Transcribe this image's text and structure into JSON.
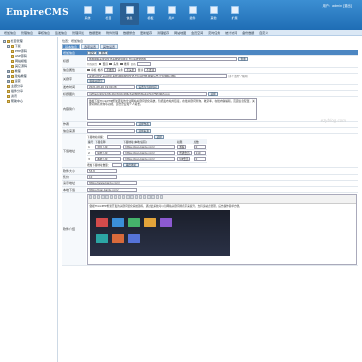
{
  "brand": {
    "logo_main": "EmpireCMS",
    "logo_sub": ""
  },
  "topnav": [
    {
      "label": "系统"
    },
    {
      "label": "栏目"
    },
    {
      "label": "信息"
    },
    {
      "label": "模板"
    },
    {
      "label": "用户"
    },
    {
      "label": "插件"
    },
    {
      "label": "其他"
    },
    {
      "label": "扩展"
    }
  ],
  "user": {
    "text": "用户：admin [退出]"
  },
  "subnav": [
    "增加信息",
    "管理信息",
    "审核信息",
    "签发信息",
    "管理评论",
    "数据更新",
    "附件管理",
    "数据整合",
    "更新缓存",
    "清理缓存",
    "网站地图",
    "会员空间",
    "定时任务",
    "统计访问",
    "备份数据",
    "自定义"
  ],
  "sidebar": {
    "items": [
      {
        "label": "栏目管理",
        "level": 0
      },
      {
        "label": "下载",
        "level": 1
      },
      {
        "label": "PHP源码",
        "level": 2
      },
      {
        "label": "ASP源码",
        "level": 2
      },
      {
        "label": "网站模板",
        "level": 2
      },
      {
        "label": "其它源码",
        "level": 2
      },
      {
        "label": "教程",
        "level": 1
      },
      {
        "label": "建站教程",
        "level": 1
      },
      {
        "label": "运营",
        "level": 1
      },
      {
        "label": "主题分享",
        "level": 1
      },
      {
        "label": "插件分享",
        "level": 1
      },
      {
        "label": "资讯",
        "level": 1
      },
      {
        "label": "帮助中心",
        "level": 1
      }
    ]
  },
  "crumb": "位置：增加信息",
  "tabs": [
    "基本信息",
    "选项设置",
    "其他设置"
  ],
  "form": {
    "section": "增加信息",
    "submit": "提交",
    "reset": "重置",
    "title_label": "标题",
    "title_value": "傲视网站关键词优化系统SEO排名 ThinkPHP内核",
    "title_btn": "查重",
    "special_label": "特殊属性",
    "special_opts": [
      "置顶",
      "头条",
      "推荐"
    ],
    "color_label": "颜色",
    "info_label": "信息属性",
    "review": "审核",
    "recommend_label": "推荐",
    "recommend_val": "不推荐",
    "headline_label": "头条",
    "headline_val": "不头条",
    "pin_label": "置顶",
    "pin_val": "不置顶",
    "keywords_label": "关键字",
    "keywords_value": "关键词优化,seo排名系统,网站SEO优化,ThinkPHP,网站后台,企业网站,建站",
    "keywords_hint": "(多个请用\",\"隔开)",
    "keywords_btn": "提取关键字",
    "date_label": "发布时间",
    "date_value": "2021-08-26 19:00:28",
    "date_btn": "设置为当前时间",
    "img_label": "标题图片",
    "img_value": "/d/file/p/2021/08-26/c8d2c486c3a0f08fd5eb17bd7f9fd9b5.jpg",
    "img_btn": "选择",
    "desc_label": "内容简介",
    "desc_value": "傲视下载ThinkPHP框架研发的企业网站关键词优化系统，包括发布站外链接，在线关键词查询，收录率，在线内容编辑，页面信息配置，关键词排名查询等功能，适合企业和个人站长。",
    "author_label": "作者",
    "author_btn": "选择作者",
    "source_label": "信息来源",
    "source_btn": "选择来源",
    "dl_label": "下载地址",
    "dl_prefix_label": "下载地址前缀：",
    "dl_prefix_btn": "选择",
    "dl_headers": [
      "编号",
      "下载名称",
      "下载地址(本地/远程)",
      "权限",
      "点数"
    ],
    "dl_rows": [
      {
        "no": "1",
        "name": "浏览下载",
        "url": "https://pan.baidu.com/",
        "perm": "游客",
        "pts": "0"
      },
      {
        "no": "2",
        "name": "站内下载",
        "url": "https://pan.baidu.com/",
        "perm": "普通会员",
        "pts": "119"
      },
      {
        "no": "3",
        "name": "本地下载",
        "url": "https://pan.baidu.com/",
        "perm": "VIP会员",
        "pts": "0"
      }
    ],
    "dl_add_label": "增加下载地址数量：",
    "dl_add_btn": "输出地址",
    "size_label": "软件大小",
    "size_value": "53.8",
    "price_label": "售价",
    "price_value": "10",
    "demo_label": "演示地址",
    "demo_value": "https://www.baidu.com/",
    "down_label": "本地下载",
    "down_value": "https://pan.baidu.com/",
    "content_label": "软件介绍",
    "content_text": "傲视ThinkPHP框架开发的关键词优化系统源码，通过此系统可以为网站关键词排名带来提升，支持多站点管理，后台操作简单方便。",
    "watermark": "ezyblog.com"
  }
}
